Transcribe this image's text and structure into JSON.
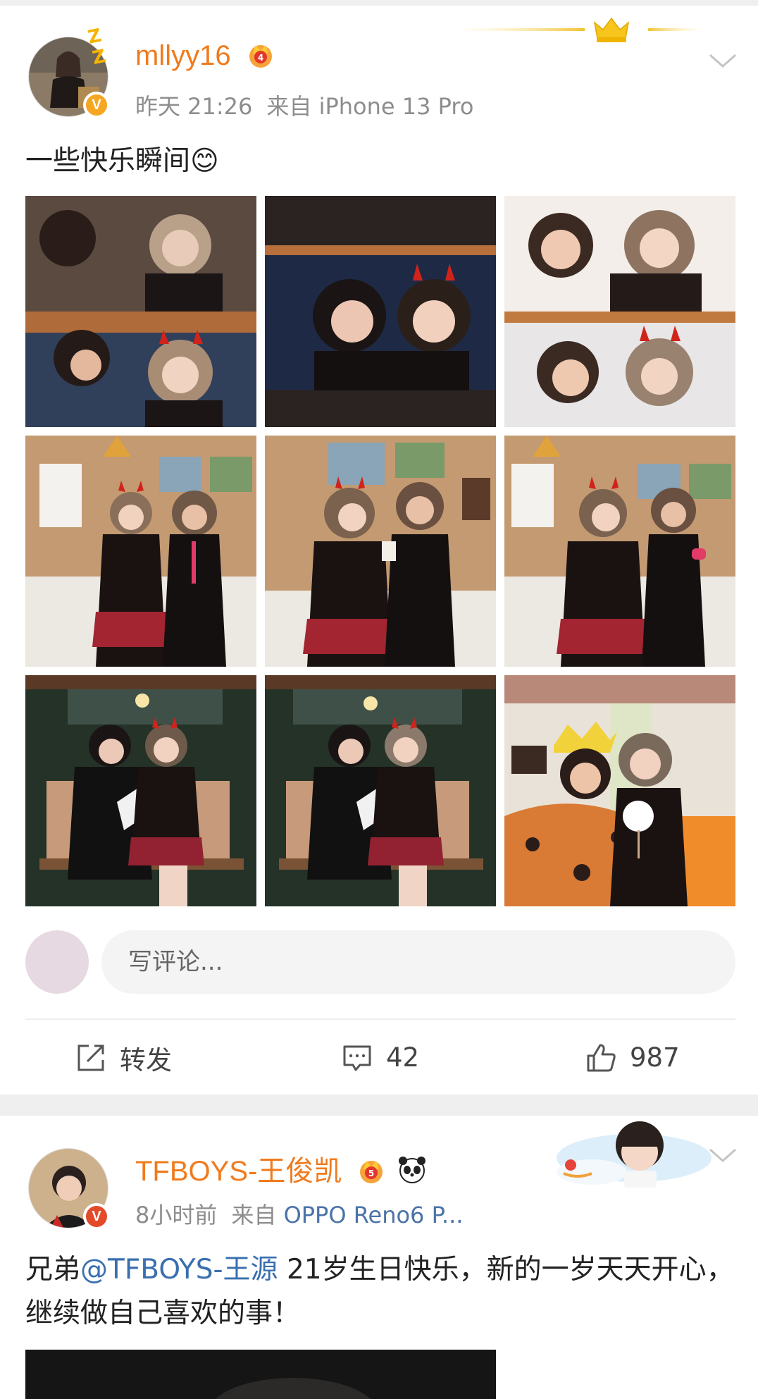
{
  "post1": {
    "username": "mllyy16",
    "time": "昨天 21:26",
    "source": "来自 iPhone 13 Pro",
    "text": "一些快乐瞬间😊",
    "comment_placeholder": "写评论...",
    "actions": {
      "repost_label": "转发",
      "comment_count": "42",
      "like_count": "987"
    }
  },
  "post2": {
    "username": "TFBOYS-王俊凯",
    "time": "8小时前",
    "source_prefix": "来自",
    "source_device": "OPPO Reno6 P...",
    "text_before": "兄弟",
    "mention": "@TFBOYS-王源",
    "text_after": " 21岁生日快乐，新的一岁天天开心，继续做自己喜欢的事！"
  },
  "colors": {
    "username": "#f07b1d",
    "meta": "#8d8d8d",
    "link": "#3a6fb0",
    "vip_badge": "#f5a623",
    "separator": "#efefef"
  },
  "icons": [
    "crown-icon",
    "verified-icon",
    "chevron-down-icon",
    "repost-icon",
    "comment-icon",
    "like-icon",
    "panda-icon"
  ]
}
